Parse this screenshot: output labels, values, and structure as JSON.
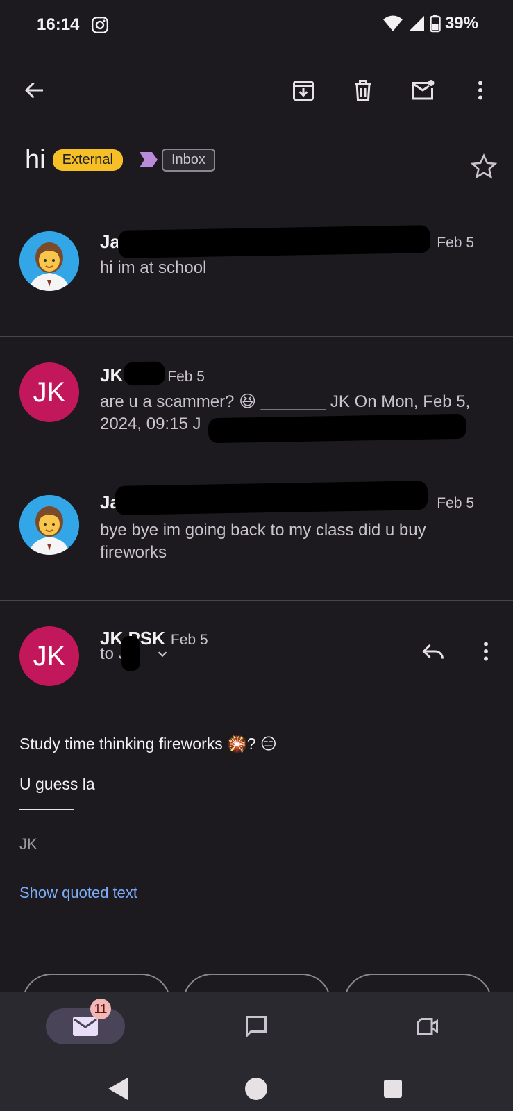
{
  "status": {
    "time": "16:14",
    "battery": "39%"
  },
  "toolbar": {
    "back": "back-arrow-icon",
    "archive": "archive-icon",
    "delete": "trash-icon",
    "mark_unread": "mark-unread-icon",
    "more": "more-vert-icon"
  },
  "thread": {
    "subject": "hi",
    "external_chip": "External",
    "inbox_chip": "Inbox"
  },
  "messages": [
    {
      "sender": "Ja",
      "date": "Feb 5",
      "snippet": "hi im at school"
    },
    {
      "sender": "JK",
      "date": "Feb 5",
      "snippet": "are u a scammer? 😆 _______ JK On Mon, Feb 5, 2024, 09:15 J"
    },
    {
      "sender": "Ja",
      "date": "Feb 5",
      "snippet": "bye bye im going back to my class did u buy fireworks"
    }
  ],
  "expanded": {
    "avatar": "JK",
    "sender": "JK PSK",
    "date": "Feb 5",
    "to": "to J",
    "body_line1": "Study time thinking fireworks 🎇? 😑",
    "body_line2": "U guess la",
    "signature": "JK",
    "show_quoted": "Show quoted text"
  },
  "nav": {
    "mail_badge": "11"
  },
  "colors": {
    "external": "#f6bf26",
    "avatar_jk": "#c2185b",
    "link": "#7cacf8"
  }
}
